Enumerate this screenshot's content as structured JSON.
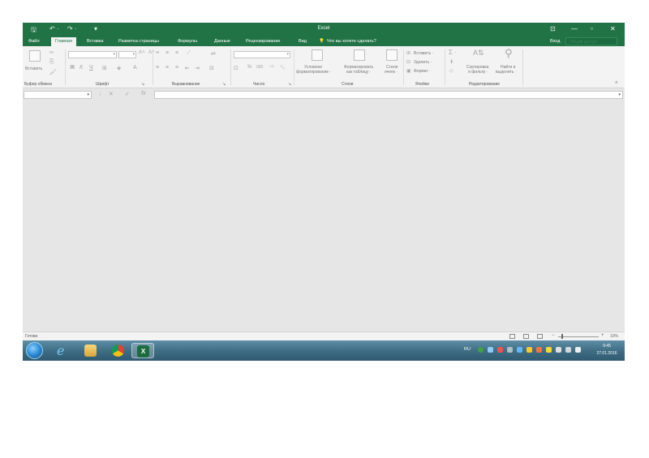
{
  "window": {
    "title": "Excel",
    "controls": {
      "restore": "⊡",
      "minimize": "—",
      "maximize": "▫",
      "close": "✕"
    }
  },
  "quick_access": {
    "save": "🖫",
    "undo": "↶ ·",
    "redo": "↷ ·",
    "customize": "▾"
  },
  "tabs": [
    {
      "label": "Файл"
    },
    {
      "label": "Главная"
    },
    {
      "label": "Вставка"
    },
    {
      "label": "Разметка страницы"
    },
    {
      "label": "Формулы"
    },
    {
      "label": "Данные"
    },
    {
      "label": "Рецензирование"
    },
    {
      "label": "Вид"
    }
  ],
  "tell_me": "Что вы хотите сделать?",
  "signin": "Вход",
  "share": "Общий доступ",
  "ribbon": {
    "clipboard": {
      "label": "Буфер обмена",
      "paste": "Вставить"
    },
    "font": {
      "label": "Шрифт",
      "bold": "Ж",
      "italic": "К",
      "underline": "Ч",
      "grow": "A˄",
      "shrink": "A˅",
      "color": "A"
    },
    "alignment": {
      "label": "Выравнивание"
    },
    "number": {
      "label": "Число",
      "percent": "%",
      "thousands": "000"
    },
    "styles": {
      "label": "Стили",
      "conditional_1": "Условное",
      "conditional_2": "форматирование ·",
      "format_table_1": "Форматировать",
      "format_table_2": "как таблицу ·",
      "cell_styles_1": "Стили",
      "cell_styles_2": "ячеек ·"
    },
    "cells": {
      "label": "Ячейки",
      "insert": "Вставить ·",
      "delete": "Удалить ·",
      "format": "Формат ·"
    },
    "editing": {
      "label": "Редактирование",
      "sort_1": "Сортировка",
      "sort_2": "и фильтр ·",
      "find_1": "Найти и",
      "find_2": "выделить ·",
      "sum": "Σ ·"
    }
  },
  "formula_bar": {
    "cancel": "✕",
    "enter": "✓",
    "fx": "fx",
    "value": ""
  },
  "status_bar": {
    "status": "Готово",
    "zoom_level": "10%",
    "zoom_fraction": 0.1,
    "zoom_minus": "−",
    "zoom_plus": "+"
  },
  "taskbar": {
    "lang": "RU",
    "time": "9:45",
    "date": "27.01.2016"
  },
  "colors": {
    "accent": "#217346",
    "workspace": "#e6e6e6",
    "ribbon": "#f3f3f3"
  }
}
